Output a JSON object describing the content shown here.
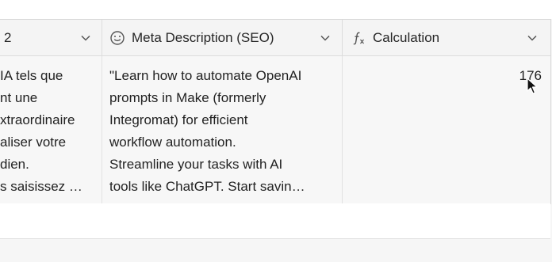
{
  "columns": [
    {
      "label": "2",
      "icon": "chevron-down-icon"
    },
    {
      "label": "Meta Description (SEO)",
      "icon": "smiley-icon"
    },
    {
      "label": "Calculation",
      "icon": "formula-icon"
    }
  ],
  "row": {
    "col1_lines": [
      "IA tels que",
      "nt une",
      "xtraordinaire",
      "aliser votre",
      "dien.",
      "s saisissez …"
    ],
    "col2_lines": [
      "\"Learn how to automate OpenAI",
      "prompts in Make (formerly",
      "Integromat) for efficient",
      "workflow automation.",
      "Streamline your tasks with AI",
      "tools like ChatGPT. Start savin…"
    ],
    "calculation_value": "176"
  }
}
